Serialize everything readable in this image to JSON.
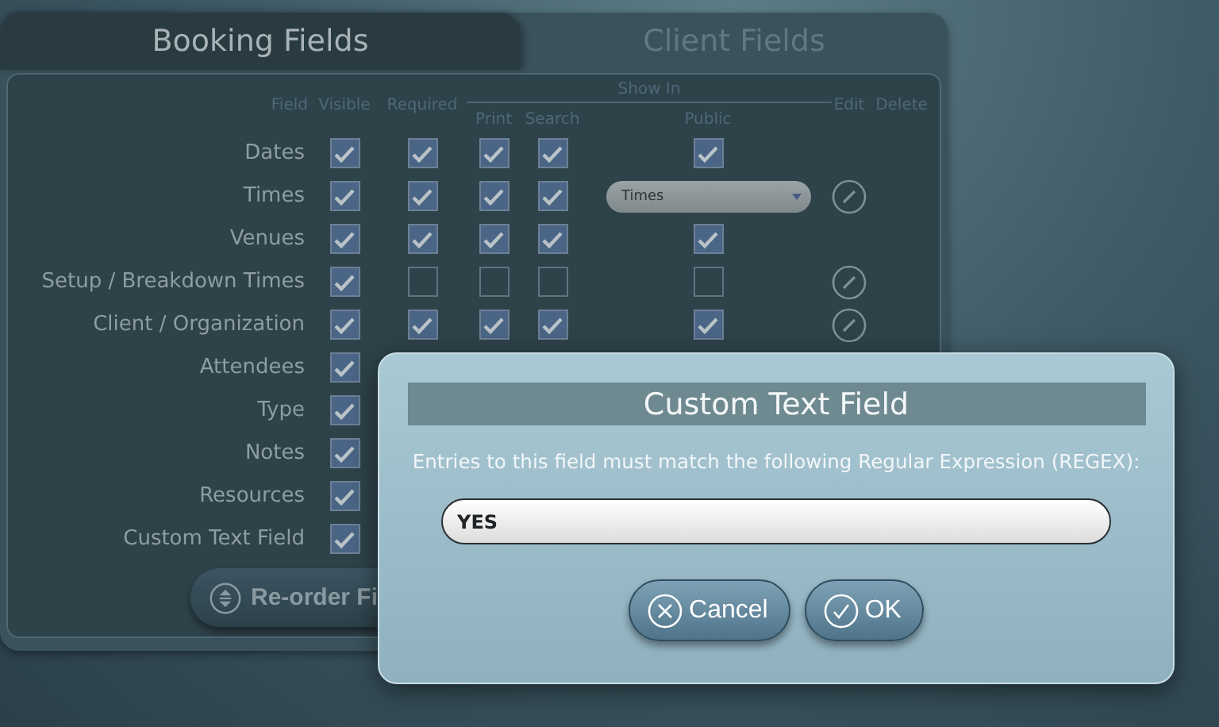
{
  "tabs": [
    {
      "label": "Booking Fields",
      "selected": true
    },
    {
      "label": "Client Fields",
      "selected": false
    }
  ],
  "columns": {
    "field": "Field",
    "visible": "Visible",
    "required": "Required",
    "show_in": "Show In",
    "print": "Print",
    "search": "Search",
    "public": "Public",
    "edit": "Edit",
    "delete": "Delete"
  },
  "rows": [
    {
      "label": "Dates",
      "visible": true,
      "required": true,
      "print": true,
      "search": true,
      "public": {
        "kind": "checkbox",
        "checked": true
      },
      "edit": false
    },
    {
      "label": "Times",
      "visible": true,
      "required": true,
      "print": true,
      "search": true,
      "public": {
        "kind": "dropdown",
        "value": "Times"
      },
      "edit": true
    },
    {
      "label": "Venues",
      "visible": true,
      "required": true,
      "print": true,
      "search": true,
      "public": {
        "kind": "checkbox",
        "checked": true
      },
      "edit": false
    },
    {
      "label": "Setup / Breakdown Times",
      "visible": true,
      "required": false,
      "print": false,
      "search": false,
      "public": {
        "kind": "checkbox",
        "checked": false
      },
      "edit": true
    },
    {
      "label": "Client / Organization",
      "visible": true,
      "required": true,
      "print": true,
      "search": true,
      "public": {
        "kind": "checkbox",
        "checked": true
      },
      "edit": true
    },
    {
      "label": "Attendees",
      "visible": true
    },
    {
      "label": "Type",
      "visible": true
    },
    {
      "label": "Notes",
      "visible": true
    },
    {
      "label": "Resources",
      "visible": true
    },
    {
      "label": "Custom Text Field",
      "visible": true
    }
  ],
  "reorder_button": {
    "label": "Re-order Fi"
  },
  "dialog": {
    "title": "Custom Text Field",
    "message": "Entries to this field must match the following Regular Expression (REGEX):",
    "input": {
      "value": "YES"
    },
    "buttons": [
      {
        "kind": "cancel",
        "label": "Cancel"
      },
      {
        "kind": "ok",
        "label": "OK"
      }
    ]
  }
}
